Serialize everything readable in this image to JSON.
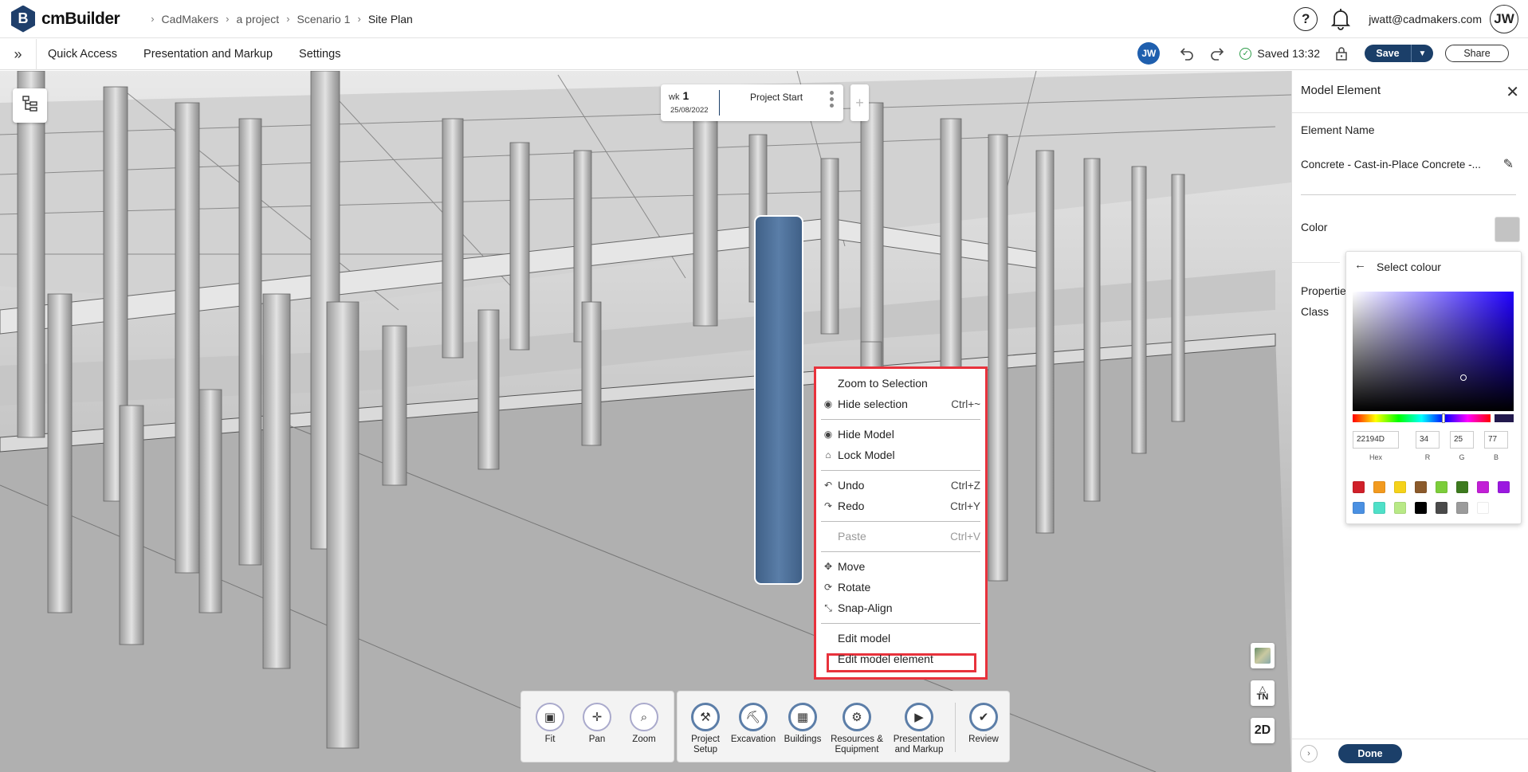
{
  "app": {
    "logo_letter": "B",
    "name": "cmBuilder"
  },
  "breadcrumb": [
    "CadMakers",
    "a project",
    "Scenario 1",
    "Site Plan"
  ],
  "header": {
    "help_glyph": "?",
    "email": "jwatt@cadmakers.com",
    "avatar_initials": "JW"
  },
  "toolbar": {
    "menu": [
      "Quick Access",
      "Presentation and Markup",
      "Settings"
    ],
    "avatar_initials": "JW",
    "saved_text": "Saved 13:32",
    "save_label": "Save",
    "share_label": "Share"
  },
  "timeline": {
    "week_label": "wk",
    "week_number": "1",
    "date": "25/08/2022",
    "title": "Project Start"
  },
  "context_menu": {
    "items": [
      {
        "label": "Zoom to Selection",
        "shortcut": "",
        "icon": "none",
        "disabled": false
      },
      {
        "label": "Hide selection",
        "shortcut": "Ctrl+~",
        "icon": "eye-icon",
        "disabled": false
      },
      {
        "label": "Hide Model",
        "shortcut": "",
        "icon": "eye-icon",
        "disabled": false
      },
      {
        "label": "Lock Model",
        "shortcut": "",
        "icon": "lock-icon",
        "disabled": false
      },
      {
        "label": "Undo",
        "shortcut": "Ctrl+Z",
        "icon": "undo-icon",
        "disabled": false
      },
      {
        "label": "Redo",
        "shortcut": "Ctrl+Y",
        "icon": "redo-icon",
        "disabled": false
      },
      {
        "label": "Paste",
        "shortcut": "Ctrl+V",
        "icon": "none",
        "disabled": true
      },
      {
        "label": "Move",
        "shortcut": "",
        "icon": "move-icon",
        "disabled": false
      },
      {
        "label": "Rotate",
        "shortcut": "",
        "icon": "rotate-icon",
        "disabled": false
      },
      {
        "label": "Snap-Align",
        "shortcut": "",
        "icon": "snap-icon",
        "disabled": false
      },
      {
        "label": "Edit model",
        "shortcut": "",
        "icon": "none",
        "disabled": false
      },
      {
        "label": "Edit model element",
        "shortcut": "",
        "icon": "none",
        "disabled": false
      }
    ],
    "highlight_color": "#e8323c"
  },
  "view_tools": [
    {
      "label": "Fit",
      "icon": "fit-icon"
    },
    {
      "label": "Pan",
      "icon": "pan-icon"
    },
    {
      "label": "Zoom",
      "icon": "zoom-icon"
    }
  ],
  "mode_tools": [
    {
      "label": "Project Setup",
      "icon": "project-setup-icon"
    },
    {
      "label": "Excavation",
      "icon": "excavation-icon"
    },
    {
      "label": "Buildings",
      "icon": "buildings-icon"
    },
    {
      "label": "Resources & Equipment",
      "icon": "resources-icon"
    },
    {
      "label": "Presentation and Markup",
      "icon": "presentation-icon"
    },
    {
      "label": "Review",
      "icon": "review-icon"
    }
  ],
  "view_side": {
    "north_label": "TN",
    "mode_2d": "2D"
  },
  "panel": {
    "title": "Model Element",
    "element_name_label": "Element Name",
    "element_name_value": "Concrete - Cast-in-Place Concrete -...",
    "color_label": "Color",
    "properties_partial": "Propertie",
    "class_partial": "Class",
    "done_label": "Done",
    "current_color": "#c3c3c3"
  },
  "color_picker": {
    "title": "Select colour",
    "hex": "22194D",
    "r": "34",
    "g": "25",
    "b": "77",
    "captions": [
      "Hex",
      "R",
      "G",
      "B"
    ],
    "swatches_row1": [
      "#d0202a",
      "#f29a1f",
      "#f5d21a",
      "#8b5a2b",
      "#7ccd3a",
      "#3d7a1e",
      "#c21fd6",
      "#9b18e0"
    ],
    "swatches_row2": [
      "#4a90e2",
      "#4fe0c8",
      "#b8e986",
      "#000000",
      "#4a4a4a",
      "#9b9b9b",
      "#ffffff"
    ]
  },
  "selected_column_color": "#4e7199"
}
